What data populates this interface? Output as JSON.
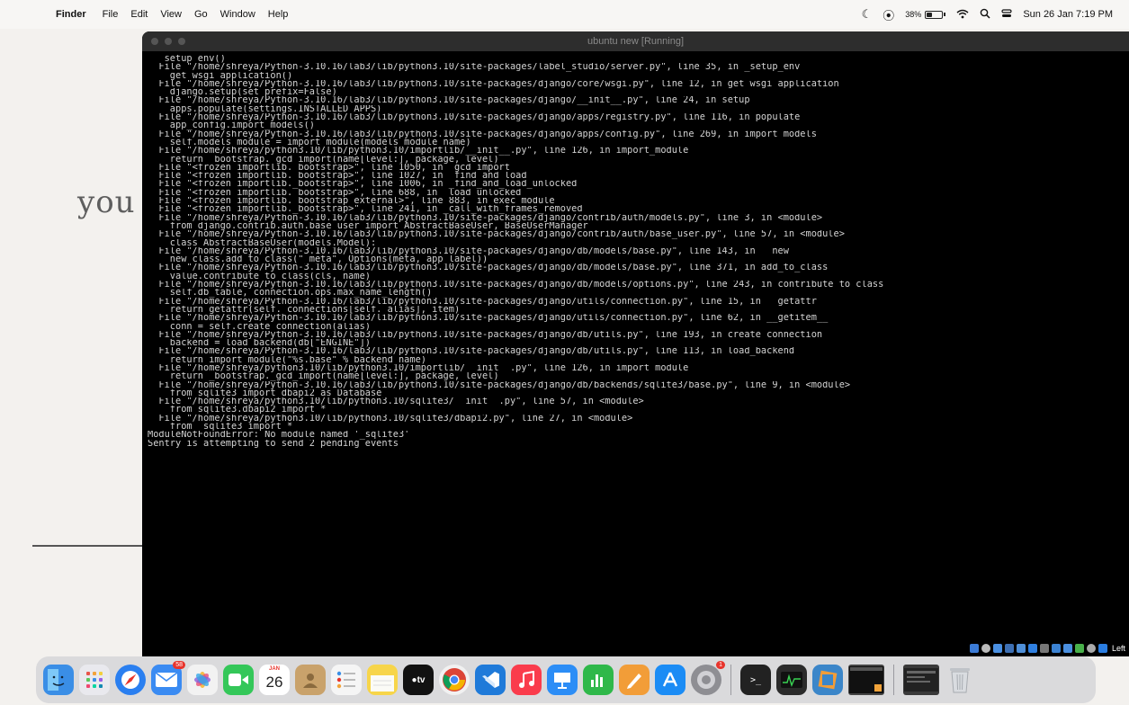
{
  "menubar": {
    "app_name": "Finder",
    "items": [
      "File",
      "Edit",
      "View",
      "Go",
      "Window",
      "Help"
    ],
    "battery_percent_text": "38%",
    "battery_level": 0.38,
    "clock": "Sun 26 Jan  7:19 PM"
  },
  "desktop": {
    "background_fragment": "you"
  },
  "vm": {
    "title": "ubuntu new [Running]",
    "status_right_label": "Left",
    "terminal_lines": [
      "  _setup_env()",
      "  File \"/home/shreya/Python-3.10.16/lab3/lib/python3.10/site-packages/label_studio/server.py\", line 35, in _setup_env",
      "    get_wsgi_application()",
      "  File \"/home/shreya/Python-3.10.16/lab3/lib/python3.10/site-packages/django/core/wsgi.py\", line 12, in get_wsgi_application",
      "    django.setup(set_prefix=False)",
      "  File \"/home/shreya/Python-3.10.16/lab3/lib/python3.10/site-packages/django/__init__.py\", line 24, in setup",
      "    apps.populate(settings.INSTALLED_APPS)",
      "  File \"/home/shreya/Python-3.10.16/lab3/lib/python3.10/site-packages/django/apps/registry.py\", line 116, in populate",
      "    app_config.import_models()",
      "  File \"/home/shreya/Python-3.10.16/lab3/lib/python3.10/site-packages/django/apps/config.py\", line 269, in import_models",
      "    self.models_module = import_module(models_module_name)",
      "  File \"/home/shreya/python3.10/lib/python3.10/importlib/__init__.py\", line 126, in import_module",
      "    return _bootstrap._gcd_import(name[level:], package, level)",
      "  File \"<frozen importlib._bootstrap>\", line 1050, in _gcd_import",
      "  File \"<frozen importlib._bootstrap>\", line 1027, in _find_and_load",
      "  File \"<frozen importlib._bootstrap>\", line 1006, in _find_and_load_unlocked",
      "  File \"<frozen importlib._bootstrap>\", line 688, in _load_unlocked",
      "  File \"<frozen importlib._bootstrap_external>\", line 883, in exec_module",
      "  File \"<frozen importlib._bootstrap>\", line 241, in _call_with_frames_removed",
      "  File \"/home/shreya/Python-3.10.16/lab3/lib/python3.10/site-packages/django/contrib/auth/models.py\", line 3, in <module>",
      "    from django.contrib.auth.base_user import AbstractBaseUser, BaseUserManager",
      "  File \"/home/shreya/Python-3.10.16/lab3/lib/python3.10/site-packages/django/contrib/auth/base_user.py\", line 57, in <module>",
      "    class AbstractBaseUser(models.Model):",
      "  File \"/home/shreya/Python-3.10.16/lab3/lib/python3.10/site-packages/django/db/models/base.py\", line 143, in __new__",
      "    new_class.add_to_class(\"_meta\", Options(meta, app_label))",
      "  File \"/home/shreya/Python-3.10.16/lab3/lib/python3.10/site-packages/django/db/models/base.py\", line 371, in add_to_class",
      "    value.contribute_to_class(cls, name)",
      "  File \"/home/shreya/Python-3.10.16/lab3/lib/python3.10/site-packages/django/db/models/options.py\", line 243, in contribute_to_class",
      "    self.db_table, connection.ops.max_name_length()",
      "  File \"/home/shreya/Python-3.10.16/lab3/lib/python3.10/site-packages/django/utils/connection.py\", line 15, in __getattr__",
      "    return getattr(self._connections[self._alias], item)",
      "  File \"/home/shreya/Python-3.10.16/lab3/lib/python3.10/site-packages/django/utils/connection.py\", line 62, in __getitem__",
      "    conn = self.create_connection(alias)",
      "  File \"/home/shreya/Python-3.10.16/lab3/lib/python3.10/site-packages/django/db/utils.py\", line 193, in create_connection",
      "    backend = load_backend(db[\"ENGINE\"])",
      "  File \"/home/shreya/Python-3.10.16/lab3/lib/python3.10/site-packages/django/db/utils.py\", line 113, in load_backend",
      "    return import_module(\"%s.base\" % backend_name)",
      "  File \"/home/shreya/python3.10/lib/python3.10/importlib/__init__.py\", line 126, in import_module",
      "    return _bootstrap._gcd_import(name[level:], package, level)",
      "  File \"/home/shreya/Python-3.10.16/lab3/lib/python3.10/site-packages/django/db/backends/sqlite3/base.py\", line 9, in <module>",
      "    from sqlite3 import dbapi2 as Database",
      "  File \"/home/shreya/python3.10/lib/python3.10/sqlite3/__init__.py\", line 57, in <module>",
      "    from sqlite3.dbapi2 import *",
      "  File \"/home/shreya/python3.10/lib/python3.10/sqlite3/dbapi2.py\", line 27, in <module>",
      "    from _sqlite3 import *",
      "ModuleNotFoundError: No module named '_sqlite3'",
      "Sentry is attempting to send 2 pending events"
    ]
  },
  "dock": {
    "mail_badge": "58",
    "calendar_month": "JAN",
    "calendar_day": "26",
    "settings_badge": "1",
    "tv_label": "tv",
    "colors": {
      "finder": "#3a8ee6",
      "launchpad": "#e9e9ee",
      "safari": "#2a7ff0",
      "mail": "#3a8bf2",
      "photos": "#f2f2f2",
      "facetime": "#34c759",
      "calendar": "#ffffff",
      "contacts": "#c9a26b",
      "reminders": "#f5f5f5",
      "notes": "#f7d54a",
      "appletv": "#111111",
      "chrome": "#f1f1f1",
      "vscode": "#1f7ad9",
      "music": "#fa3c4c",
      "keynote": "#2c8df6",
      "numbers": "#2fb84a",
      "pages": "#f29d38",
      "appstore": "#1b8cf5",
      "settings": "#8e8e93",
      "terminal": "#222222",
      "activity": "#2b2b2b",
      "virtualbox": "#3b86c9",
      "preview": "#444444",
      "gallery": "#3a3a3a",
      "trash": "#cfd2d6"
    }
  }
}
